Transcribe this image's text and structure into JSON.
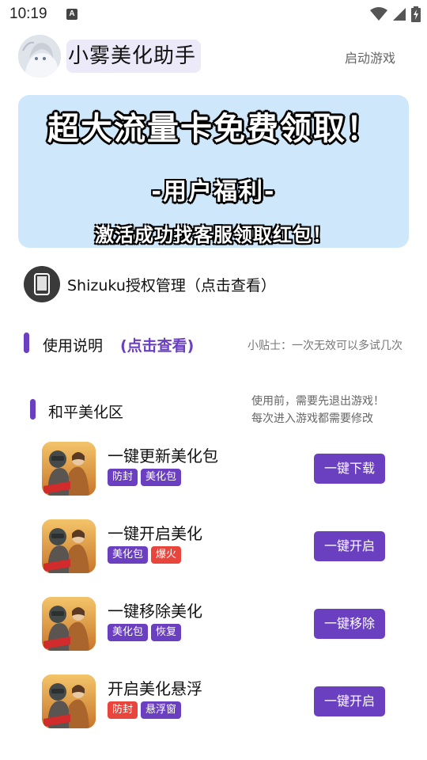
{
  "status_bar": {
    "time": "10:19",
    "notification_icon": "a-notification-icon",
    "icons": [
      "wifi-icon",
      "signal-icon",
      "battery-charging-icon"
    ]
  },
  "header": {
    "title": "小雾美化助手",
    "launch_label": "启动游戏"
  },
  "banner": {
    "title": "超大流量卡免费领取！",
    "subtitle": "-用户福利-",
    "note": "激活成功找客服领取红包！",
    "background_color": "#cfe7fb"
  },
  "shizuku": {
    "label": "Shizuku授权管理（点击查看）"
  },
  "usage": {
    "title": "使用说明",
    "link": "(点击查看)",
    "tip": "小贴士：一次无效可以多试几次"
  },
  "area": {
    "title": "和平美化区",
    "note_line1": "使用前，需要先退出游戏！",
    "note_line2": "每次进入游戏都需要修改"
  },
  "features": [
    {
      "title": "一键更新美化包",
      "tags": [
        {
          "label": "防封",
          "color": "purple"
        },
        {
          "label": "美化包",
          "color": "purple"
        }
      ],
      "button": "一键下载"
    },
    {
      "title": "一键开启美化",
      "tags": [
        {
          "label": "美化包",
          "color": "purple"
        },
        {
          "label": "爆火",
          "color": "red"
        }
      ],
      "button": "一键开启"
    },
    {
      "title": "一键移除美化",
      "tags": [
        {
          "label": "美化包",
          "color": "purple"
        },
        {
          "label": "恢复",
          "color": "purple"
        }
      ],
      "button": "一键移除"
    },
    {
      "title": "开启美化悬浮",
      "tags": [
        {
          "label": "防封",
          "color": "red"
        },
        {
          "label": "悬浮窗",
          "color": "purple"
        }
      ],
      "button": "一键开启"
    }
  ],
  "colors": {
    "accent": "#6a3fc0",
    "tag_red": "#e8453c",
    "title_highlight": "#ece9f8"
  }
}
